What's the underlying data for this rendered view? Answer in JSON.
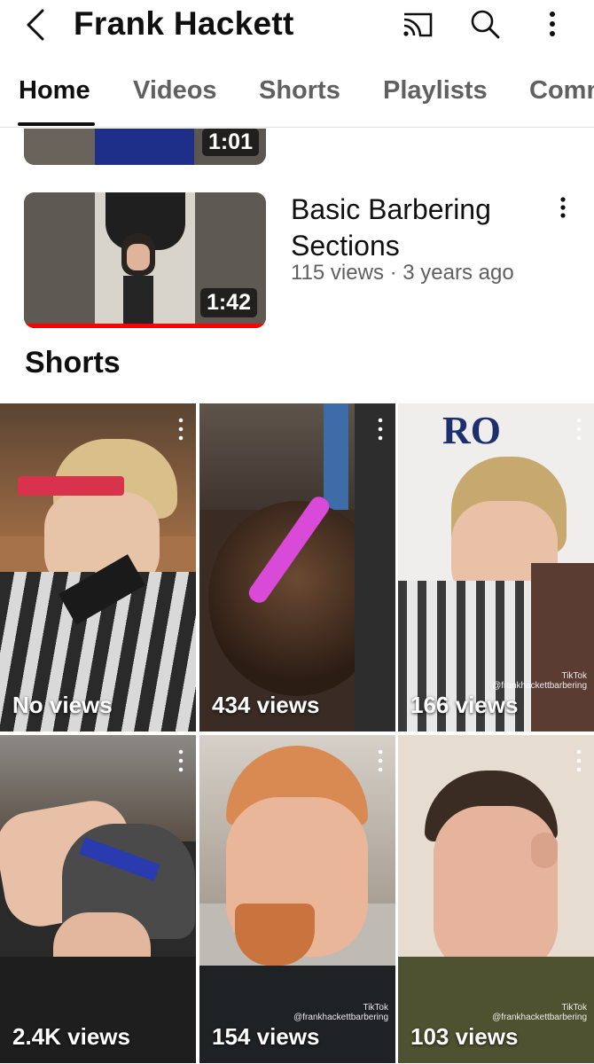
{
  "header": {
    "channel_name": "Frank Hackett"
  },
  "tabs": [
    {
      "label": "Home",
      "active": true
    },
    {
      "label": "Videos",
      "active": false
    },
    {
      "label": "Shorts",
      "active": false
    },
    {
      "label": "Playlists",
      "active": false
    },
    {
      "label": "Comm",
      "active": false
    }
  ],
  "videos": [
    {
      "duration": "1:01"
    },
    {
      "duration": "1:42",
      "title": "Basic Barbering Sections",
      "meta": "115 views · 3 years ago",
      "watched_fraction": 1.0
    }
  ],
  "shorts_section": {
    "title": "Shorts",
    "items": [
      {
        "views": "No views"
      },
      {
        "views": "434 views"
      },
      {
        "views": "166 views",
        "tiktok_label": "TikTok",
        "handle": "@frankhackettbarbering"
      },
      {
        "views": "2.4K views"
      },
      {
        "views": "154 views",
        "tiktok_label": "TikTok",
        "handle": "@frankhackettbarbering"
      },
      {
        "views": "103 views",
        "tiktok_label": "TikTok",
        "handle": "@frankhackettbarbering"
      }
    ]
  },
  "colors": {
    "text_primary": "#0f0f0f",
    "text_secondary": "#606060",
    "progress_red": "#ff0000"
  }
}
